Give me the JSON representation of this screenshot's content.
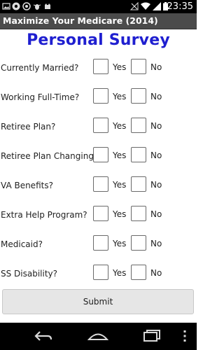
{
  "status_bar": {
    "time": "23:35",
    "left_icons": [
      "photo-icon",
      "chrome-icon",
      "circle-icon",
      "bug-icon",
      "cat-icon"
    ],
    "right_icons": [
      "signal-off-icon",
      "wifi-icon",
      "cell-signal-icon",
      "battery-icon"
    ]
  },
  "app": {
    "title": "Maximize Your Medicare (2014)"
  },
  "page": {
    "title": "Personal Survey"
  },
  "survey": {
    "yes_label": "Yes",
    "no_label": "No",
    "questions": [
      {
        "label": "Currently Married?",
        "yes_checked": false,
        "no_checked": false
      },
      {
        "label": "Working Full-Time?",
        "yes_checked": false,
        "no_checked": false
      },
      {
        "label": "Retiree Plan?",
        "yes_checked": false,
        "no_checked": false
      },
      {
        "label": "Retiree Plan Changing?",
        "yes_checked": false,
        "no_checked": false
      },
      {
        "label": "VA Benefits?",
        "yes_checked": false,
        "no_checked": false
      },
      {
        "label": "Extra Help Program?",
        "yes_checked": false,
        "no_checked": false
      },
      {
        "label": "Medicaid?",
        "yes_checked": false,
        "no_checked": false
      },
      {
        "label": "SS Disability?",
        "yes_checked": false,
        "no_checked": false
      }
    ]
  },
  "actions": {
    "submit_label": "Submit"
  },
  "nav": {
    "buttons": [
      "back-icon",
      "home-icon",
      "recent-apps-icon",
      "overflow-menu-icon"
    ]
  },
  "colors": {
    "title_blue": "#1f1fd0",
    "title_bar": "#4b4b4b",
    "status_bar": "#000000"
  }
}
